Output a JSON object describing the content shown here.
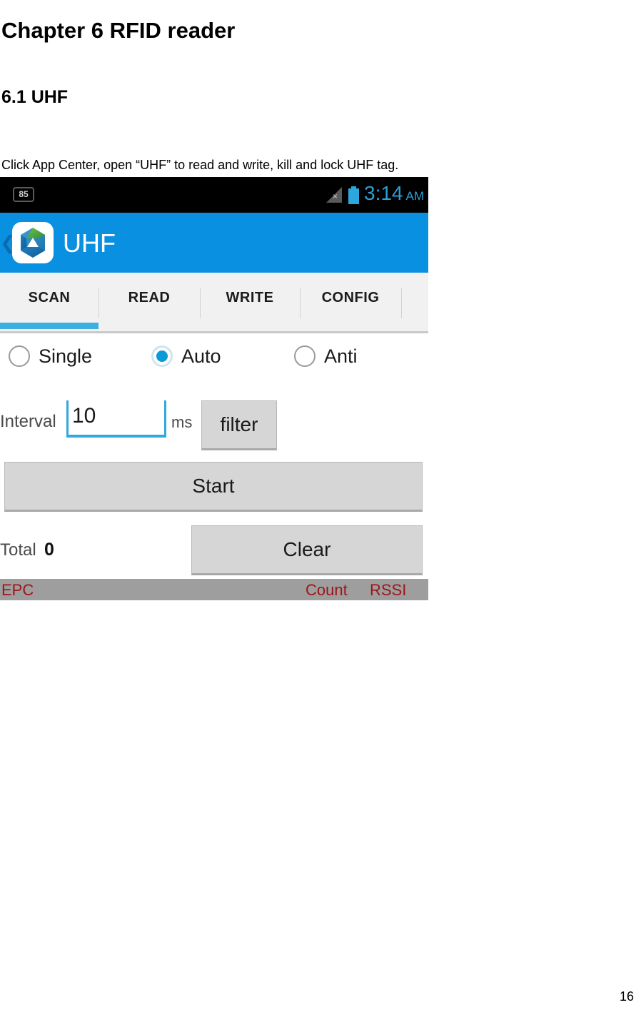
{
  "document": {
    "heading1": "Chapter 6 RFID reader",
    "heading2": "6.1 UHF",
    "paragraph": "Click App Center, open “UHF” to read and write, kill and lock UHF tag.",
    "page_number": "16"
  },
  "screenshot": {
    "status_bar": {
      "notification_badge": "85",
      "signal_icon": "signal-no-service-icon",
      "battery_icon": "battery-icon",
      "time": "3:14",
      "ampm": "AM",
      "time_color": "#2b9fd8",
      "background": "#000000"
    },
    "app_bar": {
      "back_icon": "back-chevron-icon",
      "app_icon": "uhf-app-logo-icon",
      "title": "UHF",
      "background": "#0a90e0"
    },
    "tabs": {
      "items": [
        {
          "label": "SCAN",
          "active": true
        },
        {
          "label": "READ",
          "active": false
        },
        {
          "label": "WRITE",
          "active": false
        },
        {
          "label": "CONFIG",
          "active": false
        }
      ],
      "indicator_color": "#3bb0e0",
      "background": "#f1f1f1"
    },
    "scan_panel": {
      "modes": [
        {
          "label": "Single",
          "selected": false
        },
        {
          "label": "Auto",
          "selected": true
        },
        {
          "label": "Anti",
          "selected": false
        }
      ],
      "selected_color": "#0b9ad8",
      "interval_label": "Interval",
      "interval_value": "10",
      "interval_placeholder": "10",
      "unit_label": "ms",
      "filter_button": "filter",
      "start_button": "Start",
      "total_label": "Total",
      "total_value": "0",
      "clear_button": "Clear",
      "table_header": {
        "epc": "EPC",
        "count": "Count",
        "rssi": "RSSI",
        "background": "#9e9e9e",
        "text_color": "#9e1416"
      }
    }
  }
}
